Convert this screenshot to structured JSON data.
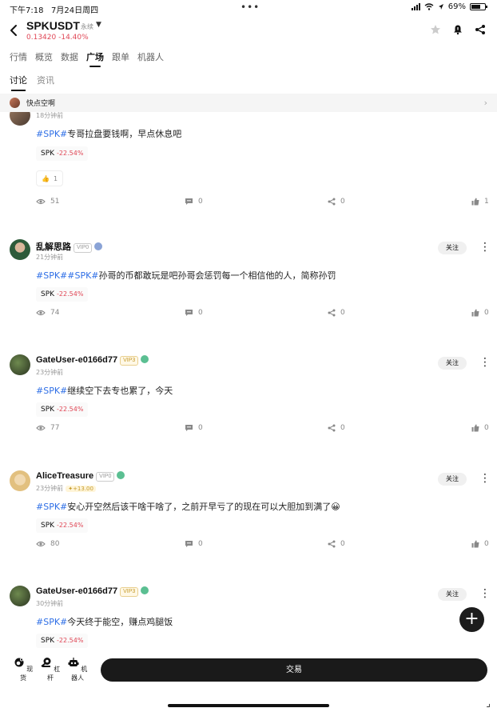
{
  "status_bar": {
    "time": "下午7:18",
    "date": "7月24日周四",
    "battery": "69%",
    "battery_level": 0.69
  },
  "header": {
    "symbol": "SPKUSDT",
    "contract_type": "永续",
    "price": "0.13420",
    "change": "-14.40%"
  },
  "nav_tabs": [
    "行情",
    "概览",
    "数据",
    "广场",
    "跟单",
    "机器人"
  ],
  "active_nav_tab": "广场",
  "sub_tabs": [
    "讨论",
    "资讯"
  ],
  "active_sub_tab": "讨论",
  "banner": {
    "text": "快点空啊"
  },
  "posts": [
    {
      "time": "18分钟前",
      "tags": [
        "#SPK#"
      ],
      "text": "专哥拉盘要钱啊，早点休息吧",
      "coin": "SPK",
      "coin_change": "-22.54%",
      "reaction_count": "1",
      "views": "51",
      "comments": "0",
      "shares": "0",
      "likes": "1"
    },
    {
      "username": "乱解思路",
      "vip": "VIP0",
      "time": "21分钟前",
      "follow_label": "关注",
      "tags": [
        "#SPK#",
        "#SPK#"
      ],
      "text": "孙哥的币都敢玩是吧孙哥会惩罚每一个相信他的人，简称孙罚",
      "coin": "SPK",
      "coin_change": "-22.54%",
      "views": "74",
      "comments": "0",
      "shares": "0",
      "likes": "0"
    },
    {
      "username": "GateUser-e0166d77",
      "vip": "VIP3",
      "time": "23分钟前",
      "follow_label": "关注",
      "tags": [
        "#SPK#"
      ],
      "text": "继续空下去专也累了，今天",
      "coin": "SPK",
      "coin_change": "-22.54%",
      "views": "77",
      "comments": "0",
      "shares": "0",
      "likes": "0"
    },
    {
      "username": "AliceTreasure",
      "vip": "VIP0",
      "time": "23分钟前",
      "tip": "+13.00",
      "follow_label": "关注",
      "tags": [
        "#SPK#"
      ],
      "text": "安心开空然后该干啥干啥了，之前开早亏了的现在可以大胆加到满了😀",
      "coin": "SPK",
      "coin_change": "-22.54%",
      "views": "80",
      "comments": "0",
      "shares": "0",
      "likes": "0"
    },
    {
      "username": "GateUser-e0166d77",
      "vip": "VIP3",
      "time": "30分钟前",
      "follow_label": "关注",
      "tags": [
        "#SPK#"
      ],
      "text": "今天终于能空，赚点鸡腿饭",
      "coin": "SPK",
      "coin_change": "-22.54%"
    }
  ],
  "bottom_nav": [
    {
      "label": "现货",
      "icon": "spot-icon"
    },
    {
      "label": "杠杆",
      "icon": "margin-icon"
    },
    {
      "label": "机器人",
      "icon": "robot-icon"
    }
  ],
  "trade_button": "交易",
  "colors": {
    "down": "#e04756",
    "hashtag": "#2f6fe6",
    "dark_button": "#1a1a1a"
  }
}
